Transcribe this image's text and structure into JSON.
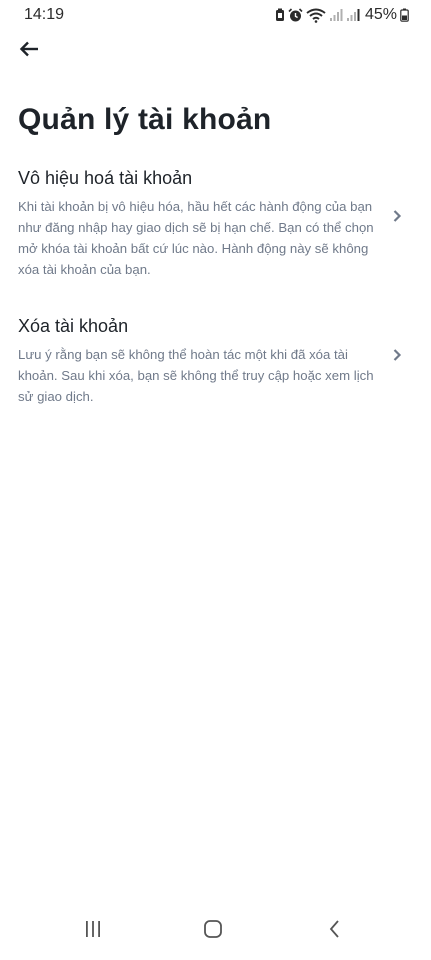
{
  "status_bar": {
    "time": "14:19",
    "battery": "45%",
    "icons": [
      "battery-saver-icon",
      "alarm-icon",
      "wifi-icon",
      "signal-icon",
      "signal-icon",
      "battery-icon"
    ]
  },
  "header": {
    "back_icon": "arrow-left-icon",
    "title": "Quản lý tài khoản"
  },
  "options": [
    {
      "title": "Vô hiệu hoá tài khoản",
      "description": "Khi tài khoản bị vô hiệu hóa, hầu hết các hành động của bạn như đăng nhập hay giao dịch sẽ bị hạn chế. Bạn có thể chọn mở khóa tài khoản bất cứ lúc nào. Hành động này sẽ không xóa tài khoản của bạn.",
      "icon": "chevron-right-icon"
    },
    {
      "title": "Xóa tài khoản",
      "description": "Lưu ý rằng bạn sẽ không thể hoàn tác một khi đã xóa tài khoản. Sau khi xóa, bạn sẽ không thể truy cập hoặc xem lịch sử giao dịch.",
      "icon": "chevron-right-icon"
    }
  ],
  "nav_bar": {
    "icons": [
      "recents-icon",
      "home-icon",
      "back-icon"
    ]
  },
  "colors": {
    "text_primary": "#1e2329",
    "text_secondary": "#707a8a",
    "chevron": "#707a8a",
    "background": "#ffffff"
  }
}
